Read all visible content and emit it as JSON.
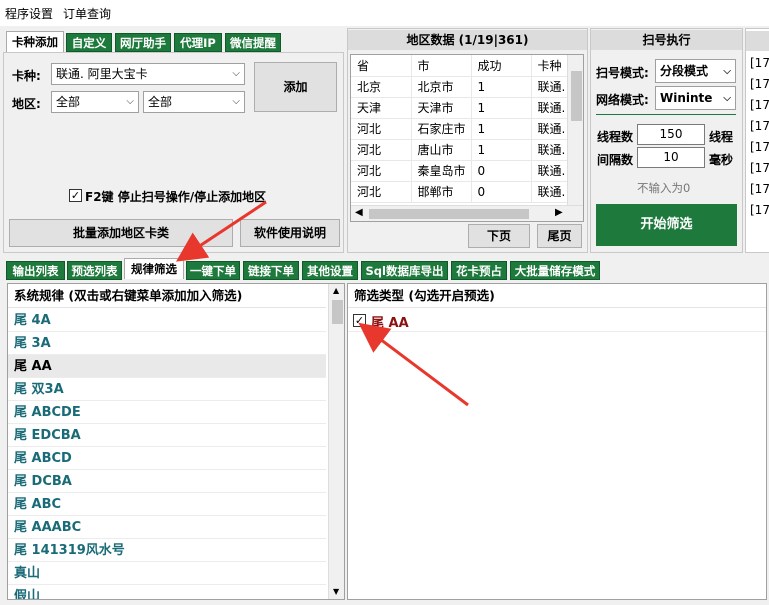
{
  "menu": {
    "items": [
      "程序设置",
      "订单查询"
    ]
  },
  "top_tabs": [
    "卡种添加",
    "自定义",
    "网厅助手",
    "代理IP",
    "微信提醒"
  ],
  "add_panel": {
    "card_type_label": "卡种:",
    "card_type_value": "联通. 阿里大宝卡",
    "region_label": "地区:",
    "region1_value": "全部",
    "region2_value": "全部",
    "add_button": "添加",
    "f2_label": "F2键 停止扫号操作/停止添加地区",
    "f2_checked": true,
    "batch_button": "批量添加地区卡类",
    "manual_button": "软件使用说明"
  },
  "region_data": {
    "title": "地区数据 (1/19|361)",
    "columns": [
      "省",
      "市",
      "成功",
      "卡种"
    ],
    "rows": [
      [
        "北京",
        "北京市",
        "1",
        "联通."
      ],
      [
        "天津",
        "天津市",
        "1",
        "联通."
      ],
      [
        "河北",
        "石家庄市",
        "1",
        "联通."
      ],
      [
        "河北",
        "唐山市",
        "1",
        "联通."
      ],
      [
        "河北",
        "秦皇岛市",
        "0",
        "联通."
      ],
      [
        "河北",
        "邯郸市",
        "0",
        "联通."
      ]
    ],
    "next_button": "下页",
    "last_button": "尾页"
  },
  "scan_exec": {
    "title": "扫号执行",
    "mode_label": "扫号模式:",
    "mode_value": "分段模式",
    "net_label": "网络模式:",
    "net_value": "Wininte",
    "threads_label": "线程数",
    "threads_value": "150",
    "threads_unit": "线程",
    "interval_label": "间隔数",
    "interval_value": "10",
    "interval_unit": "毫秒",
    "hint": "不输入为0",
    "start_button": "开始筛选"
  },
  "log_lines": [
    "[17",
    "[17",
    "[17",
    "[17",
    "[17",
    "[17",
    "[17",
    "[17"
  ],
  "bottom_tabs": [
    "输出列表",
    "预选列表",
    "规律筛选",
    "一键下单",
    "链接下单",
    "其他设置",
    "Sql数据库导出",
    "花卡预占",
    "大批量储存模式"
  ],
  "rules_panel": {
    "header": "系统规律 (双击或右键菜单添加加入筛选)",
    "items": [
      "尾 4A",
      "尾 3A",
      "尾 AA",
      "尾 双3A",
      "尾 ABCDE",
      "尾 EDCBA",
      "尾 ABCD",
      "尾 DCBA",
      "尾 ABC",
      "尾 AAABC",
      "尾 141319风水号",
      "真山",
      "假山"
    ],
    "selected_index": 2
  },
  "filter_panel": {
    "header": "筛选类型 (勾选开启预选)",
    "items": [
      {
        "label": "尾 AA",
        "checked": true
      }
    ]
  },
  "colors": {
    "accent_green": "#1e7a3c",
    "arrow_red": "#e8372c",
    "rule_text": "#1a6b78"
  }
}
